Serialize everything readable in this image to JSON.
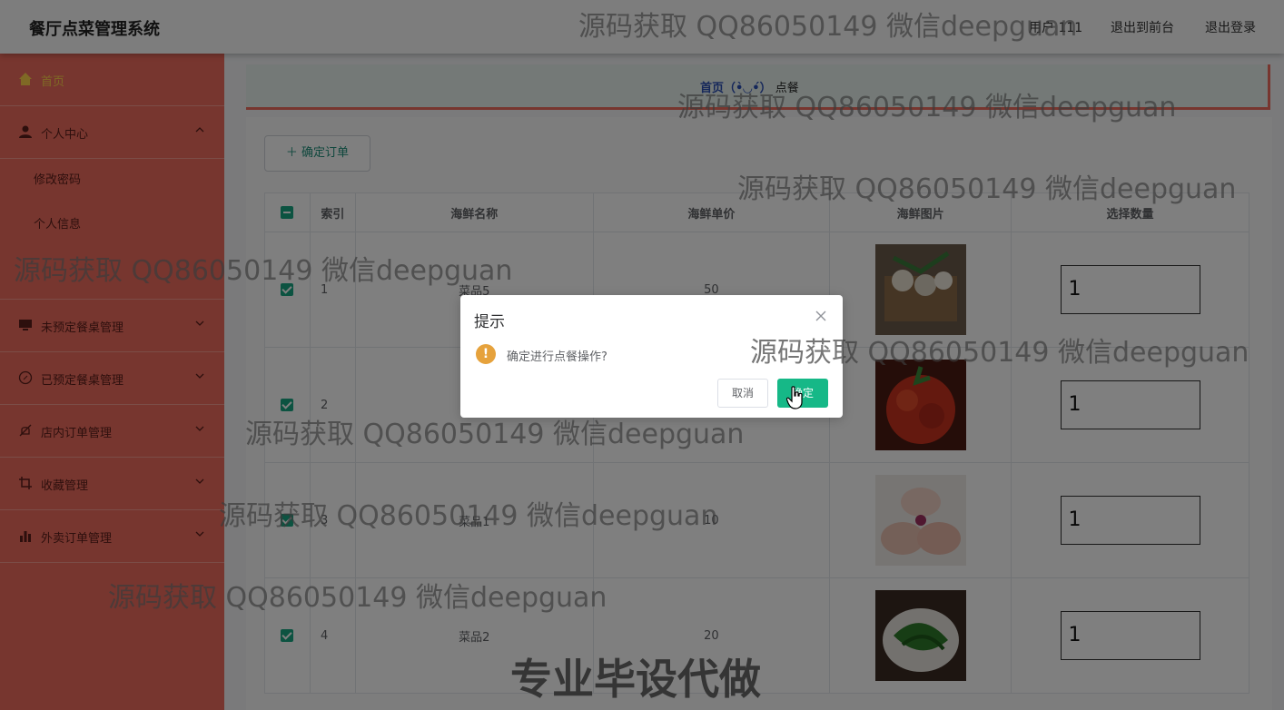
{
  "header": {
    "title": "餐厅点菜管理系统",
    "user": "用户 111",
    "to_front": "退出到前台",
    "logout": "退出登录"
  },
  "sidebar": {
    "items": [
      {
        "label": "首页",
        "icon": "home-icon"
      },
      {
        "label": "个人中心",
        "icon": "user-icon"
      },
      {
        "label": "修改密码"
      },
      {
        "label": "个人信息"
      },
      {
        "label": "未预定餐桌管理",
        "icon": "monitor-icon"
      },
      {
        "label": "已预定餐桌管理",
        "icon": "compass-icon"
      },
      {
        "label": "店内订单管理",
        "icon": "bell-off-icon"
      },
      {
        "label": "收藏管理",
        "icon": "crop-icon"
      },
      {
        "label": "外卖订单管理",
        "icon": "bar-chart-icon"
      }
    ]
  },
  "breadcrumb": {
    "home": "首页（•̀◡•́）",
    "current": "点餐"
  },
  "toolbar": {
    "confirm_order": "＋ 确定订单"
  },
  "table": {
    "columns": [
      "索引",
      "海鲜名称",
      "海鲜单价",
      "海鲜图片",
      "选择数量"
    ],
    "rows": [
      {
        "index": "1",
        "name": "菜品5",
        "price": "50",
        "qty": "1"
      },
      {
        "index": "2",
        "name": "",
        "price": "",
        "qty": "1"
      },
      {
        "index": "3",
        "name": "菜品1",
        "price": "10",
        "qty": "1"
      },
      {
        "index": "4",
        "name": "菜品2",
        "price": "20",
        "qty": "1"
      }
    ]
  },
  "dialog": {
    "title": "提示",
    "message": "确定进行点餐操作?",
    "cancel": "取消",
    "ok": "确定"
  },
  "watermarks": {
    "text": "源码获取 QQ86050149 微信deepguan",
    "bottom": "专业毕设代做"
  },
  "colors": {
    "sidebar": "#ef6c5e",
    "primary": "#16b887",
    "warning": "#e6a23c"
  }
}
